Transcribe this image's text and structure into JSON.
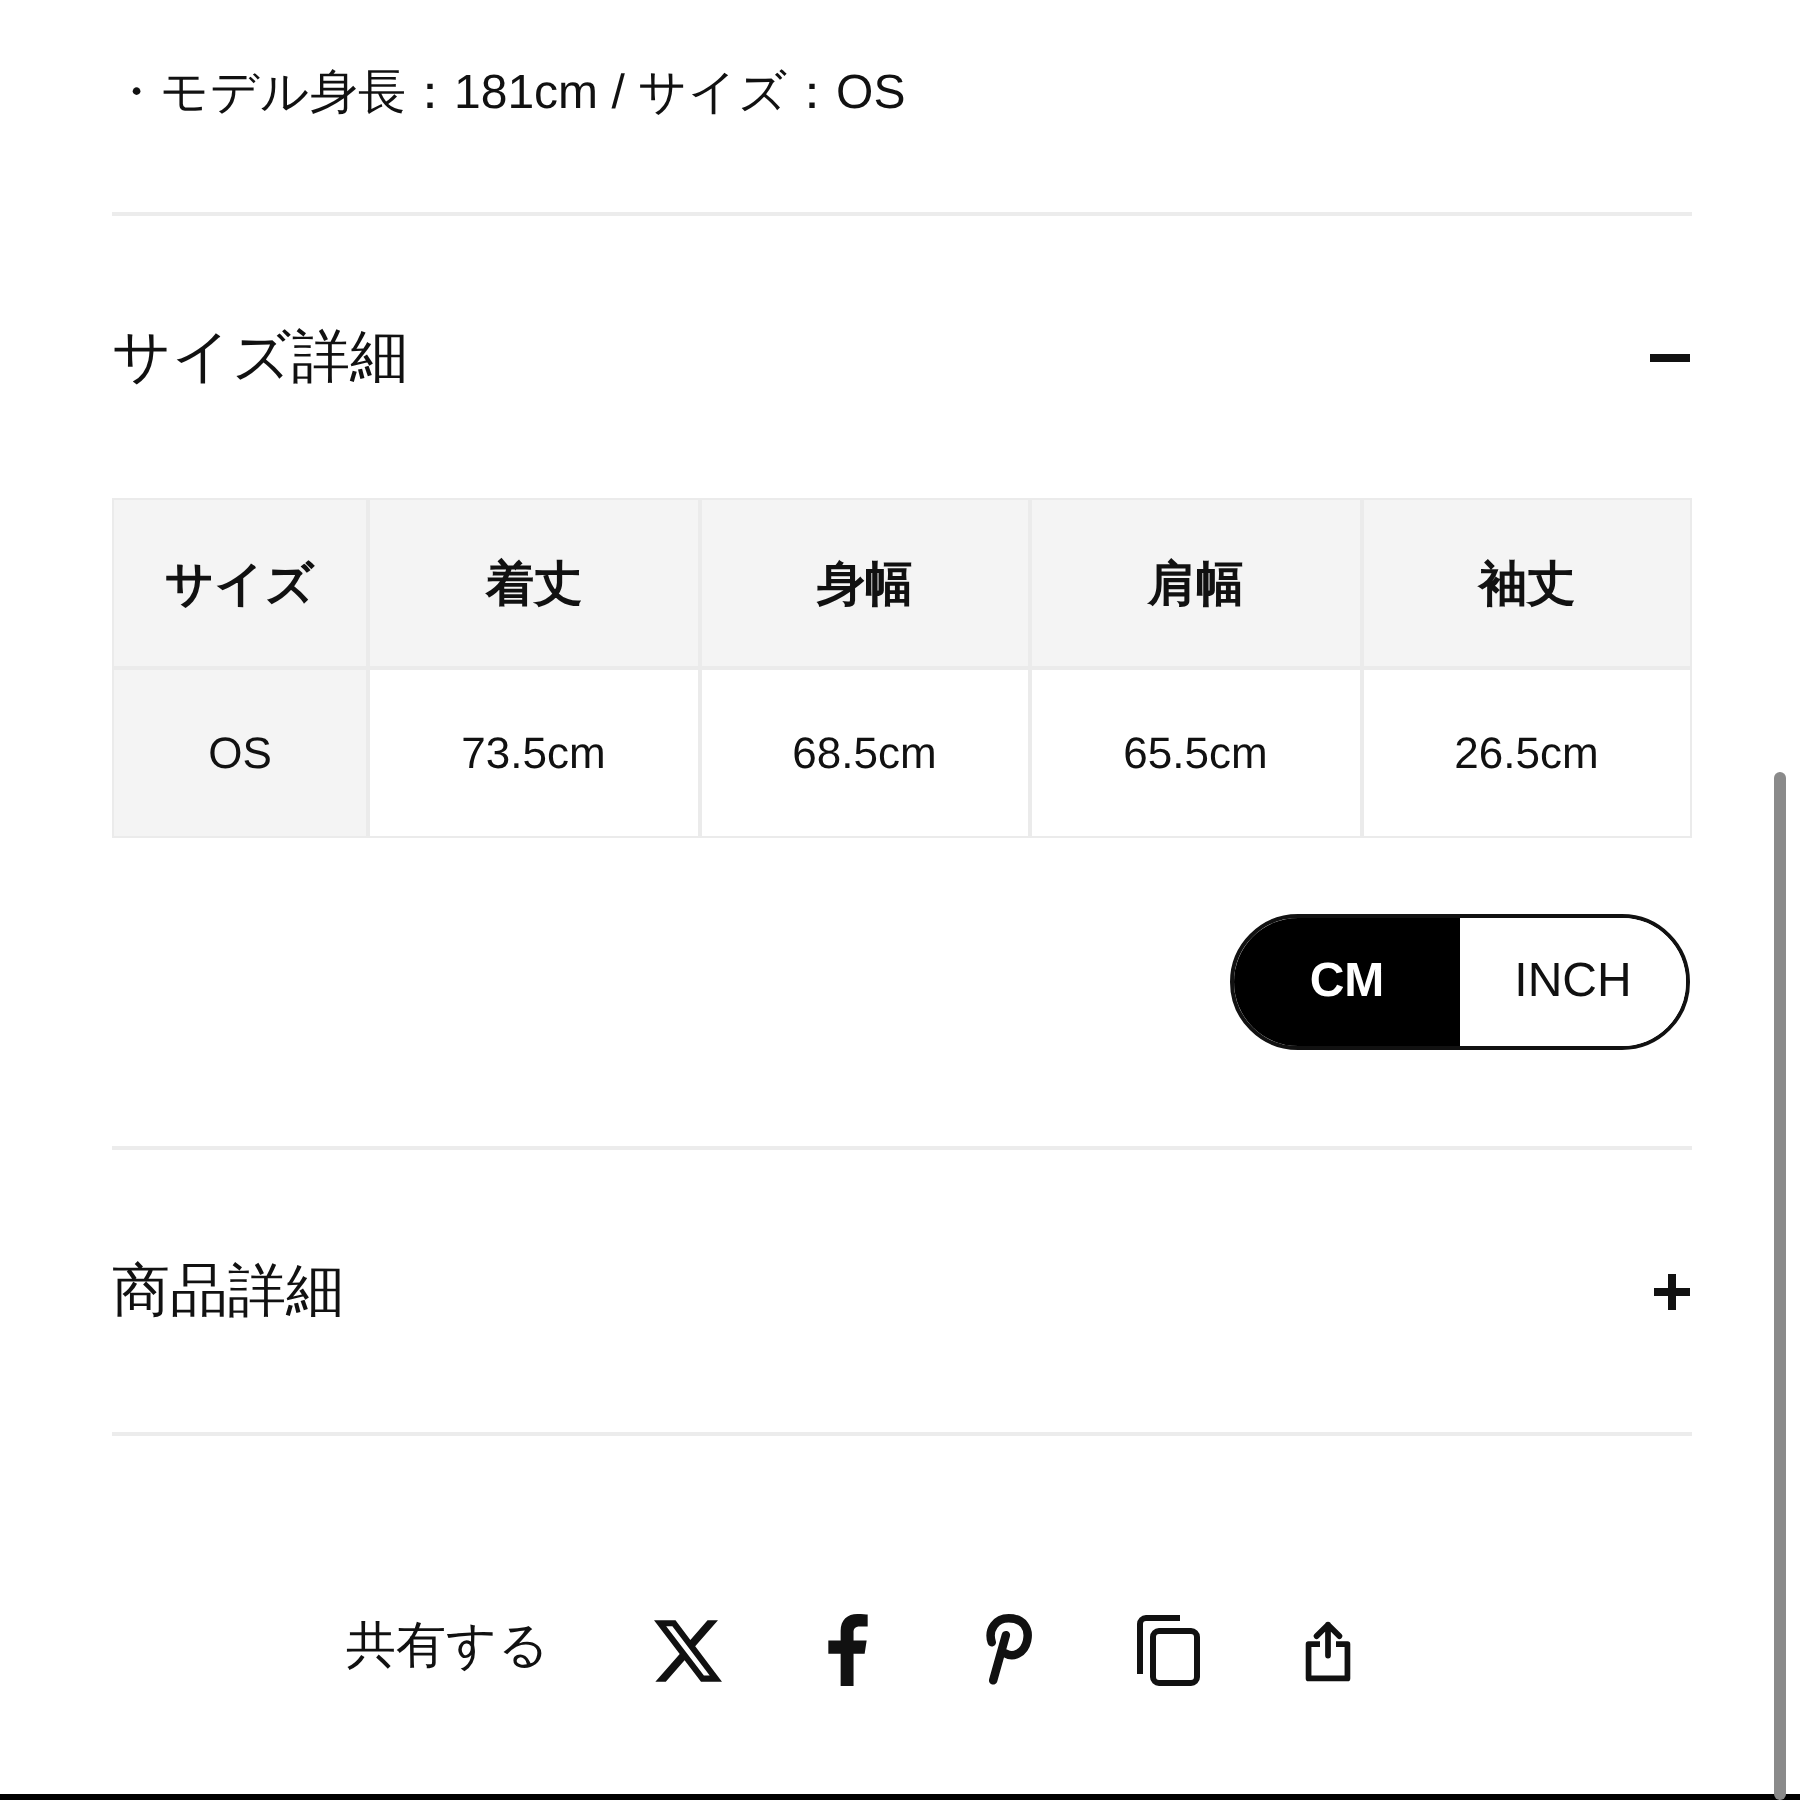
{
  "model_note": "・モデル身長：181cm / サイズ：OS",
  "sections": [
    {
      "title": "サイズ詳細",
      "expanded": true,
      "size_table": {
        "columns": [
          "サイズ",
          "着丈",
          "身幅",
          "肩幅",
          "袖丈"
        ],
        "rows": [
          [
            "OS",
            "73.5cm",
            "68.5cm",
            "65.5cm",
            "26.5cm"
          ]
        ]
      },
      "unit_toggle": [
        {
          "label": "CM",
          "selected": true
        },
        {
          "label": "INCH",
          "selected": false
        }
      ]
    },
    {
      "title": "商品詳細",
      "expanded": false
    }
  ],
  "share": {
    "label": "共有する",
    "buttons": [
      {
        "kind": "x"
      },
      {
        "kind": "facebook"
      },
      {
        "kind": "pinterest"
      },
      {
        "kind": "copy"
      },
      {
        "kind": "share"
      }
    ]
  }
}
